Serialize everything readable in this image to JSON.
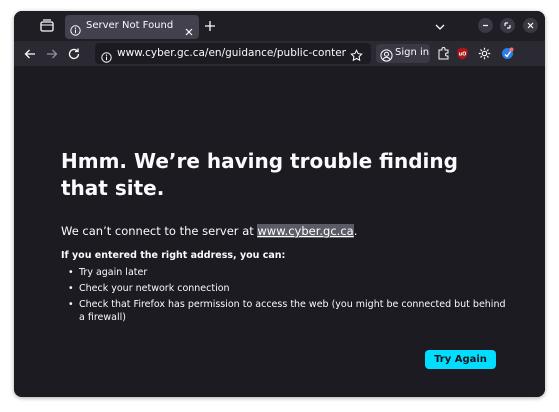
{
  "tab": {
    "title": "Server Not Found"
  },
  "toolbar": {
    "url": "www.cyber.gc.ca/en/guidance/public-content-prove",
    "signin_label": "Sign in"
  },
  "error": {
    "heading": "Hmm. We’re having trouble finding that site.",
    "lead_prefix": "We can’t connect to the server at ",
    "host": "www.cyber.gc.ca",
    "lead_suffix": ".",
    "subhead": "If you entered the right address, you can:",
    "tips": [
      "Try again later",
      "Check your network connection",
      "Check that Firefox has permission to access the web (you might be connected but behind a firewall)"
    ],
    "try_again_label": "Try Again"
  },
  "icons": {
    "tab_list": "tab-list-icon",
    "info": "info-icon",
    "close": "close-icon",
    "new_tab": "plus-icon",
    "list_all_tabs": "chevron-down-icon",
    "minimize": "minimize-icon",
    "restore": "restore-icon",
    "close_window": "close-window-icon",
    "back": "back-arrow-icon",
    "forward": "forward-arrow-icon",
    "reload": "reload-icon",
    "bookmark": "star-icon",
    "account": "account-icon",
    "extensions": [
      "extensions-puzzle-icon",
      "ublock-icon",
      "gear-extension-icon",
      "shield-extension-icon"
    ]
  },
  "colors": {
    "page_background": "#1c1b22",
    "tab_active": "#42414d",
    "toolbar": "#2b2a33",
    "primary_button": "#00ddff",
    "text": "#fbfbfe"
  }
}
